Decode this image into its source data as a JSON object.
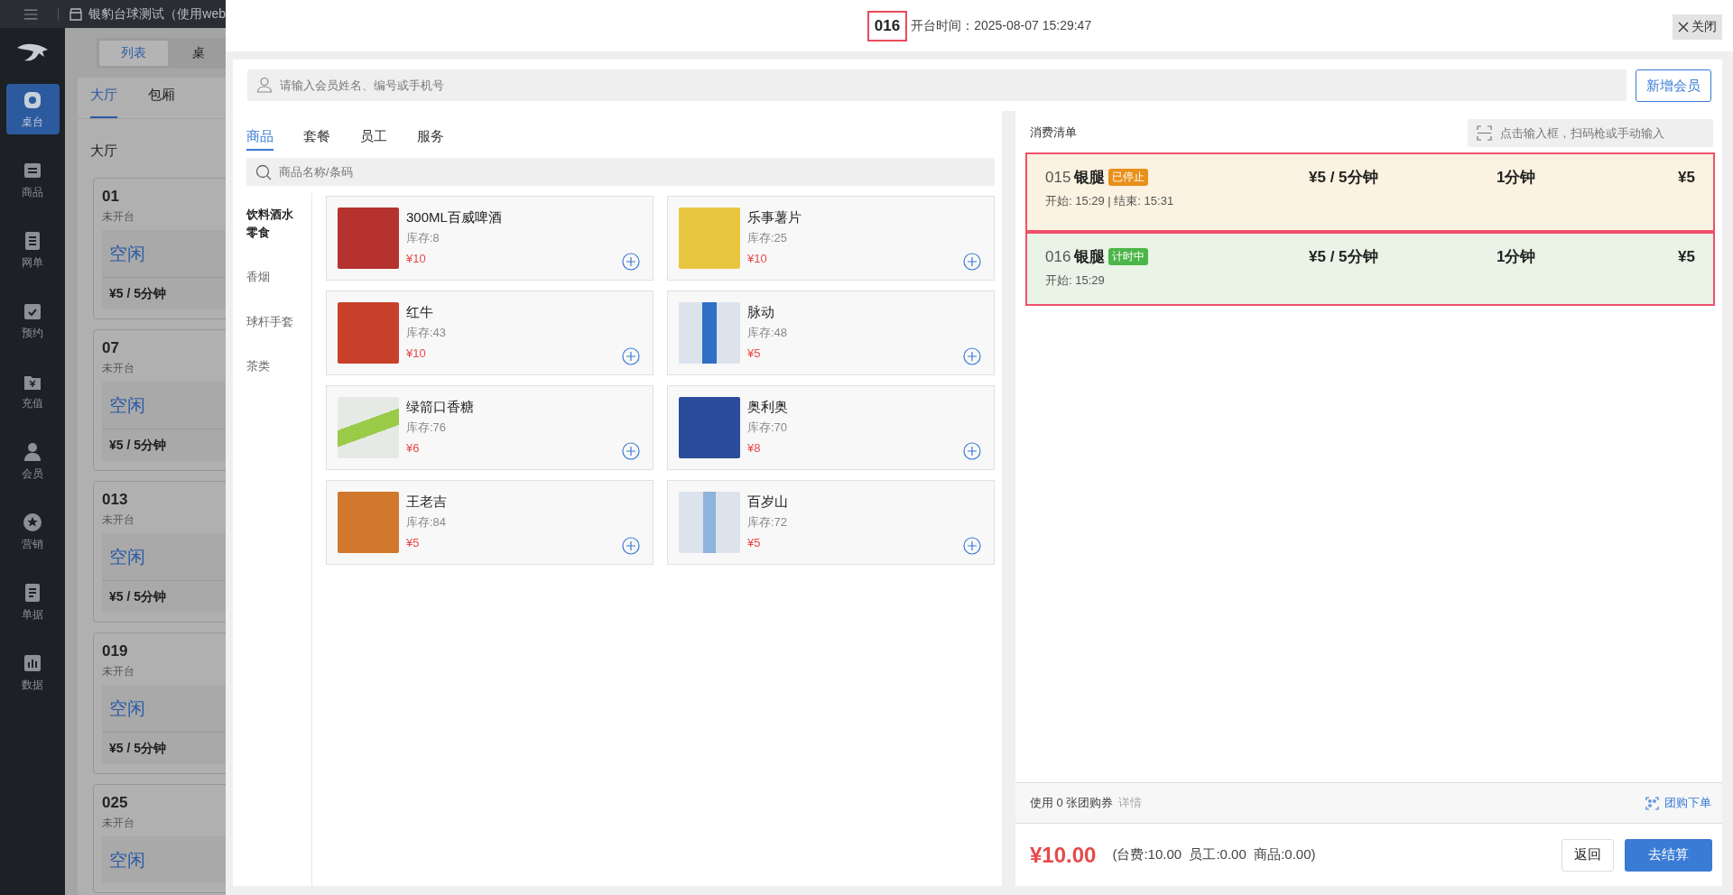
{
  "top_bar": {
    "title": "银豹台球测试（使用web"
  },
  "nav": [
    {
      "label": "桌台",
      "selected": true
    },
    {
      "label": "商品",
      "selected": false
    },
    {
      "label": "网单",
      "selected": false
    },
    {
      "label": "预约",
      "selected": false
    },
    {
      "label": "充值",
      "selected": false
    },
    {
      "label": "会员",
      "selected": false
    },
    {
      "label": "营销",
      "selected": false
    },
    {
      "label": "单据",
      "selected": false
    },
    {
      "label": "数据",
      "selected": false
    }
  ],
  "view_tabs": [
    {
      "label": "列表",
      "selected": true
    },
    {
      "label": "桌",
      "selected": false
    }
  ],
  "area_tabs": [
    {
      "label": "大厅",
      "selected": true
    },
    {
      "label": "包厢",
      "selected": false
    }
  ],
  "section_title": "大厅",
  "tables": [
    {
      "number": "01",
      "status": "未开台",
      "state": "空闲",
      "price": "¥5 / 5分钟"
    },
    {
      "number": "07",
      "status": "未开台",
      "state": "空闲",
      "price": "¥5 / 5分钟"
    },
    {
      "number": "013",
      "status": "未开台",
      "state": "空闲",
      "price": "¥5 / 5分钟"
    },
    {
      "number": "019",
      "status": "未开台",
      "state": "空闲",
      "price": "¥5 / 5分钟"
    },
    {
      "number": "025",
      "status": "未开台",
      "state": "空闲"
    }
  ],
  "dialog": {
    "table_number": "016",
    "open_time": "开台时间：2025-08-07 15:29:47",
    "close": "关闭",
    "member_search": {
      "placeholder": "请输入会员姓名、编号或手机号"
    },
    "add_member": "新增会员",
    "tabs": [
      {
        "label": "商品",
        "selected": true
      },
      {
        "label": "套餐",
        "selected": false
      },
      {
        "label": "员工",
        "selected": false
      },
      {
        "label": "服务",
        "selected": false
      }
    ],
    "product_search": {
      "placeholder": "商品名称/条码"
    },
    "categories": [
      {
        "label": "饮料酒水零食",
        "selected": true
      },
      {
        "label": "香烟",
        "selected": false
      },
      {
        "label": "球杆手套",
        "selected": false
      },
      {
        "label": "茶类",
        "selected": false
      }
    ],
    "products": [
      {
        "name": "300ML百威啤酒",
        "stock": "库存:8",
        "price": "¥10"
      },
      {
        "name": "乐事薯片",
        "stock": "库存:25",
        "price": "¥10"
      },
      {
        "name": "红牛",
        "stock": "库存:43",
        "price": "¥10"
      },
      {
        "name": "脉动",
        "stock": "库存:48",
        "price": "¥5"
      },
      {
        "name": "绿箭口香糖",
        "stock": "库存:76",
        "price": "¥6"
      },
      {
        "name": "奥利奥",
        "stock": "库存:70",
        "price": "¥8"
      },
      {
        "name": "王老吉",
        "stock": "库存:84",
        "price": "¥5"
      },
      {
        "name": "百岁山",
        "stock": "库存:72",
        "price": "¥5"
      }
    ],
    "order": {
      "title": "消费清单",
      "scan": {
        "placeholder": "点击输入框，扫码枪或手动输入"
      },
      "items": [
        {
          "kind": "stopped",
          "code": "015",
          "name": "银腿",
          "tag": "已停止",
          "rate": "¥5 / 5分钟",
          "duration": "1分钟",
          "amount": "¥5",
          "time": "开始: 15:29 | 结束: 15:31"
        },
        {
          "kind": "running",
          "code": "016",
          "name": "银腿",
          "tag": "计时中",
          "rate": "¥5 / 5分钟",
          "duration": "1分钟",
          "amount": "¥5",
          "time": "开始: 15:29"
        }
      ]
    },
    "coupon": {
      "text": "使用 0 张团购券",
      "details": "详情",
      "group_order": "团购下单"
    },
    "total": "¥10.00",
    "breakdown": "(台费:10.00  员工:0.00  商品:0.00)",
    "buttons": {
      "back": "返回",
      "checkout": "去结算"
    }
  }
}
